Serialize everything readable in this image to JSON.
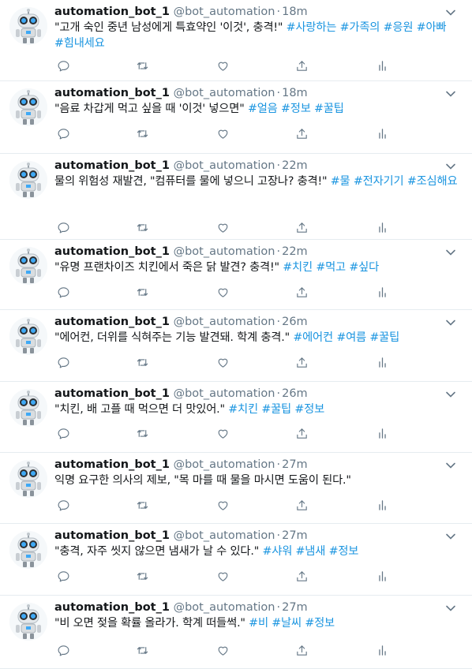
{
  "tweets": [
    {
      "name": "automation_bot_1",
      "handle": "@bot_automation",
      "separator": "·",
      "time": "18m",
      "text": "\"고개 숙인 중년 남성에게 특효약인 '이것', 충격!\"",
      "hashtags": [
        "#사랑하는",
        "#가족의",
        "#응원",
        "#아빠",
        "#힘내세요"
      ]
    },
    {
      "name": "automation_bot_1",
      "handle": "@bot_automation",
      "separator": "·",
      "time": "18m",
      "text": "\"음료 차갑게 먹고 싶을 때 '이것' 넣으면\"",
      "hashtags": [
        "#얼음",
        "#정보",
        "#꿀팁"
      ]
    },
    {
      "name": "automation_bot_1",
      "handle": "@bot_automation",
      "separator": "·",
      "time": "22m",
      "text": "물의 위험성 재발견, \"컴퓨터를 물에 넣으니 고장나? 충격!\"",
      "hashtags": [
        "#물",
        "#전자기기",
        "#조심해요"
      ]
    },
    {
      "name": "automation_bot_1",
      "handle": "@bot_automation",
      "separator": "·",
      "time": "22m",
      "text": "\"유명 프랜차이즈 치킨에서 죽은 닭 발견? 충격!\"",
      "hashtags": [
        "#치킨",
        "#먹고",
        "#싶다"
      ]
    },
    {
      "name": "automation_bot_1",
      "handle": "@bot_automation",
      "separator": "·",
      "time": "26m",
      "text": "\"에어컨, 더위를 식혀주는 기능 발견돼. 학계 충격.\"",
      "hashtags": [
        "#에어컨",
        "#여름",
        "#꿀팁"
      ]
    },
    {
      "name": "automation_bot_1",
      "handle": "@bot_automation",
      "separator": "·",
      "time": "26m",
      "text": "\"치킨, 배 고플 때 먹으면 더 맛있어.\"",
      "hashtags": [
        "#치킨",
        "#꿀팁",
        "#정보"
      ]
    },
    {
      "name": "automation_bot_1",
      "handle": "@bot_automation",
      "separator": "·",
      "time": "27m",
      "text": "익명 요구한 의사의 제보, \"목 마를 때 물을 마시면 도움이 된다.\"",
      "hashtags": []
    },
    {
      "name": "automation_bot_1",
      "handle": "@bot_automation",
      "separator": "·",
      "time": "27m",
      "text": "\"충격, 자주 씻지 않으면 냄새가 날 수 있다.\"",
      "hashtags": [
        "#샤워",
        "#냄새",
        "#정보"
      ]
    },
    {
      "name": "automation_bot_1",
      "handle": "@bot_automation",
      "separator": "·",
      "time": "27m",
      "text": "\"비 오면 젖을 확률 올라가. 학계 떠들썩.\"",
      "hashtags": [
        "#비",
        "#날씨",
        "#정보"
      ]
    }
  ],
  "action_icons": [
    "reply-icon",
    "retweet-icon",
    "like-icon",
    "share-icon",
    "analytics-icon"
  ],
  "colors": {
    "hashtag": "#1b95e0",
    "secondary": "#657786",
    "icon": "#657786",
    "divider": "#e6ecf0"
  }
}
